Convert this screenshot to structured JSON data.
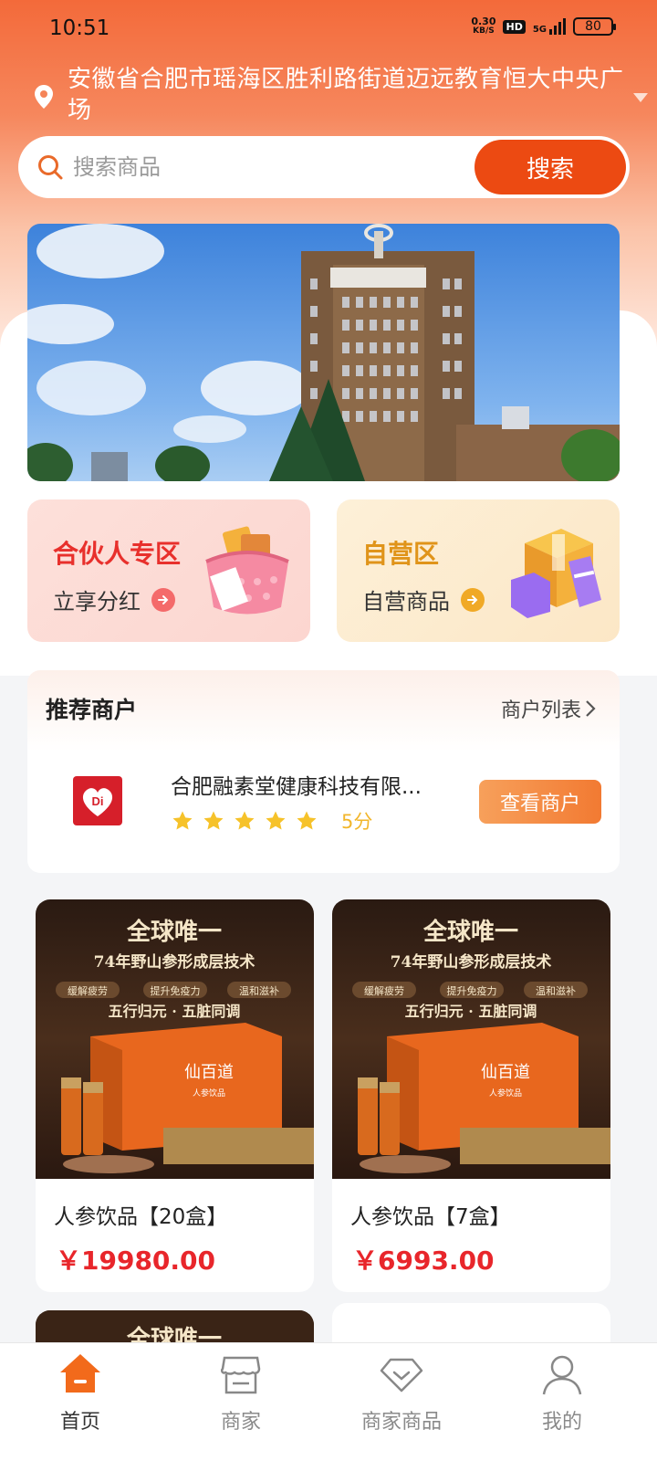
{
  "status_bar": {
    "time": "10:51",
    "net_speed_value": "0.30",
    "net_speed_unit": "KB/S",
    "hd": "HD",
    "network": "5G",
    "battery": "80"
  },
  "location": {
    "address": "安徽省合肥市瑶海区胜利路街道迈远教育恒大中央广场"
  },
  "search": {
    "placeholder": "搜索商品",
    "button_label": "搜索"
  },
  "zones": {
    "partner": {
      "title": "合伙人专区",
      "subtitle": "立享分红"
    },
    "self_operated": {
      "title": "自营区",
      "subtitle": "自营商品"
    }
  },
  "recommended_merchants": {
    "title": "推荐商户",
    "list_link": "商户列表",
    "merchant": {
      "name": "合肥融素堂健康科技有限...",
      "rating_stars": 5,
      "score_text": "5分",
      "view_button": "查看商户"
    }
  },
  "products": [
    {
      "name": "人参饮品【20盒】",
      "price": "￥19980.00",
      "image_headline": "全球唯一",
      "image_subline": "74年野山参形成层技术",
      "image_tags": [
        "缓解疲劳",
        "提升免疫力",
        "温和滋补"
      ],
      "image_motto": "五行归元 · 五脏同调",
      "image_brand": "仙百道",
      "image_product": "人参饮品"
    },
    {
      "name": "人参饮品【7盒】",
      "price": "￥6993.00",
      "image_headline": "全球唯一",
      "image_subline": "74年野山参形成层技术",
      "image_tags": [
        "缓解疲劳",
        "提升免疫力",
        "温和滋补"
      ],
      "image_motto": "五行归元 · 五脏同调",
      "image_brand": "仙百道",
      "image_product": "人参饮品"
    },
    {
      "image_headline": "全球唯一"
    }
  ],
  "bottom_nav": [
    {
      "label": "首页",
      "icon": "home-icon",
      "active": true
    },
    {
      "label": "商家",
      "icon": "store-icon",
      "active": false
    },
    {
      "label": "商家商品",
      "icon": "diamond-icon",
      "active": false
    },
    {
      "label": "我的",
      "icon": "user-icon",
      "active": false
    }
  ],
  "colors": {
    "brand_orange": "#ec4a12",
    "price_red": "#e8262b",
    "partner_red": "#e8302c",
    "self_gold": "#e0941a",
    "star_yellow": "#f6c22a"
  }
}
